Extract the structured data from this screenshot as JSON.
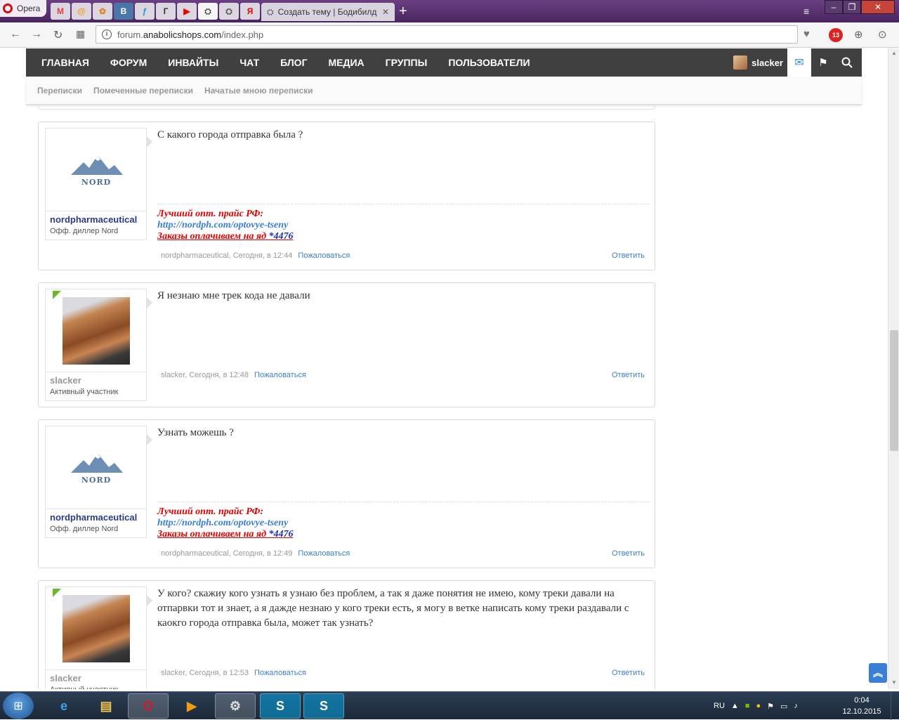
{
  "browser": {
    "opera_label": "Opera",
    "tab_title": "Создать тему | Бодибилд",
    "url_prefix": "forum.",
    "url_domain": "anabolicshops.com",
    "url_path": "/index.php",
    "adblock_badge": "13"
  },
  "nav": {
    "items": [
      "ГЛАВНАЯ",
      "ФОРУМ",
      "ИНВАЙТЫ",
      "ЧАТ",
      "БЛОГ",
      "МЕДИА",
      "ГРУППЫ",
      "ПОЛЬЗОВАТЕЛИ"
    ],
    "username": "slacker"
  },
  "subnav": {
    "items": [
      "Переписки",
      "Помеченные переписки",
      "Начатые мною переписки"
    ]
  },
  "posts": [
    {
      "author": "nordpharmaceutical",
      "role": "Офф. диллер Nord",
      "text": "С какого города отправка была ?",
      "sig_line1": "Лучший опт. прайс РФ:",
      "sig_line2": "http://nordph.com/optovye-tseny",
      "sig_line3": "Заказы оплачиваем на яд ",
      "sig_line3_link": "*4476",
      "meta": "nordpharmaceutical, Сегодня, в 12:44",
      "report": "Пожаловаться",
      "reply": "Ответить"
    },
    {
      "author": "slacker",
      "role": "Активный участник",
      "text": "Я незнаю мне трек кода не давали",
      "meta": "slacker, Сегодня, в 12:48",
      "report": "Пожаловаться",
      "reply": "Ответить"
    },
    {
      "author": "nordpharmaceutical",
      "role": "Офф. диллер Nord",
      "text": "Узнать можешь ?",
      "sig_line1": "Лучший опт. прайс РФ:",
      "sig_line2": "http://nordph.com/optovye-tseny",
      "sig_line3": "Заказы оплачиваем на яд ",
      "sig_line3_link": "*4476",
      "meta": "nordpharmaceutical, Сегодня, в 12:49",
      "report": "Пожаловаться",
      "reply": "Ответить"
    },
    {
      "author": "slacker",
      "role": "Активный участник",
      "text": "У кого? скажиу кого узнать я узнаю без проблем, а так я даже понятия не имею, кому треки давали на отпарвки тот и знает, а я дажде незнаю у кого треки есть, я могу в ветке написать кому треки раздавали с каокго города отправка была, может так узнать?",
      "meta": "slacker, Сегодня, в 12:53",
      "report": "Пожаловаться",
      "reply": "Ответить"
    }
  ],
  "logo_text": "NORD",
  "taskbar": {
    "lang": "RU",
    "time": "0:04",
    "date": "12.10.2015"
  },
  "colors": {
    "nav_bg": "#404040",
    "link": "#3a7fd6",
    "sig_red": "#e00000"
  }
}
